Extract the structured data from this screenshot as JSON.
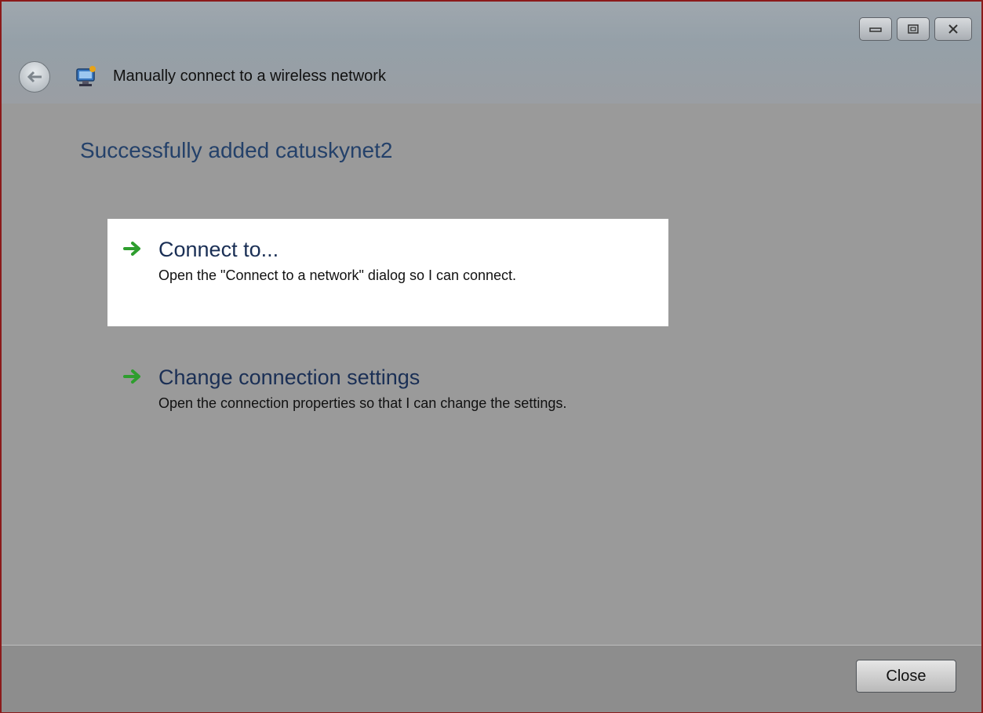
{
  "window": {
    "title": "Manually connect to a wireless network",
    "controls": {
      "minimize_icon": "minimize-icon",
      "restore_icon": "restore-icon",
      "close_icon": "close-x-icon"
    },
    "back_icon": "back-arrow-icon",
    "app_icon": "network-wizard-icon"
  },
  "main": {
    "heading": "Successfully added catuskynet2",
    "options": [
      {
        "icon": "green-arrow-icon",
        "title": "Connect to...",
        "description": "Open the \"Connect to a network\" dialog so I can connect."
      },
      {
        "icon": "green-arrow-icon",
        "title": "Change connection settings",
        "description": "Open the connection properties so that I can change the settings."
      }
    ]
  },
  "footer": {
    "close_label": "Close"
  },
  "colors": {
    "heading": "#24416a",
    "arrow": "#2e9e2e",
    "window_border": "#8b1a1a"
  }
}
